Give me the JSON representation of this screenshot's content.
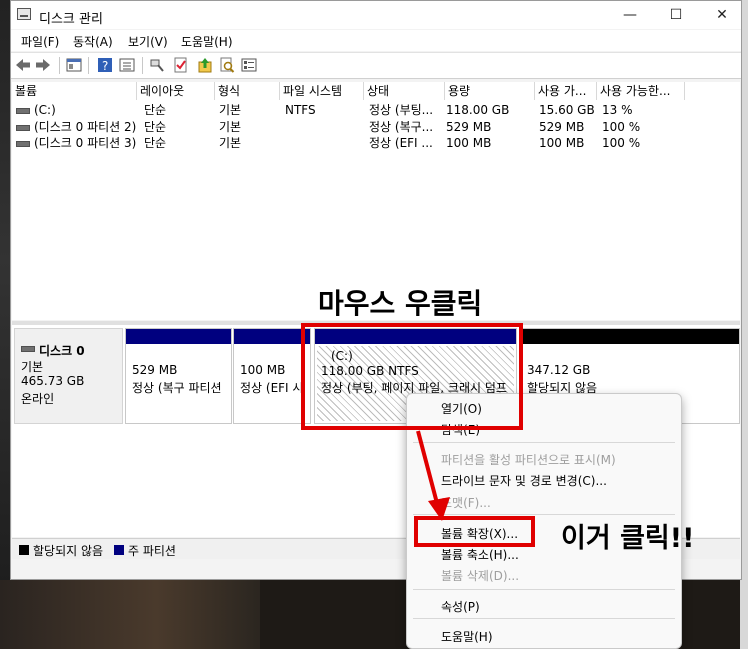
{
  "window": {
    "title": "디스크 관리",
    "minimize": "—",
    "maximize": "☐",
    "close": "✕"
  },
  "menu": [
    "파일(F)",
    "동작(A)",
    "보기(V)",
    "도움말(H)"
  ],
  "toolbar_icons": [
    "back-arrow-icon",
    "forward-arrow-icon",
    "console-icon",
    "help-icon",
    "properties-icon",
    "connect-icon",
    "check-icon",
    "upload-icon",
    "search-icon",
    "list-icon"
  ],
  "volume_table": {
    "headers": [
      "볼륨",
      "레이아웃",
      "형식",
      "파일 시스템",
      "상태",
      "용량",
      "사용 가...",
      "사용 가능한..."
    ],
    "rows": [
      [
        "(C:)",
        "단순",
        "기본",
        "NTFS",
        "정상 (부팅...",
        "118.00 GB",
        "15.60 GB",
        "13 %"
      ],
      [
        "(디스크 0 파티션 2)",
        "단순",
        "기본",
        "",
        "정상 (복구...",
        "529 MB",
        "529 MB",
        "100 %"
      ],
      [
        "(디스크 0 파티션 3)",
        "단순",
        "기본",
        "",
        "정상 (EFI ...",
        "100 MB",
        "100 MB",
        "100 %"
      ]
    ]
  },
  "disk": {
    "name": "디스크 0",
    "type": "기본",
    "size": "465.73 GB",
    "status": "온라인"
  },
  "partitions": [
    {
      "label": "",
      "size": "529 MB",
      "status": "정상 (복구 파티션"
    },
    {
      "label": "",
      "size": "100 MB",
      "status": "정상 (EFI 시"
    },
    {
      "label": "(C:)",
      "size": "118.00 GB NTFS",
      "status": "정상 (부팅, 페이지 파일, 크래시 덤프"
    },
    {
      "label": "",
      "size": "347.12 GB",
      "status": "할당되지 않음"
    }
  ],
  "legend": [
    {
      "label": "할당되지 않음",
      "color": "#000000"
    },
    {
      "label": "주 파티션",
      "color": "#00007f"
    }
  ],
  "context_menu": [
    {
      "label": "열기(O)",
      "enabled": true
    },
    {
      "label": "탐색(E)",
      "enabled": true
    },
    {
      "label": "파티션을 활성 파티션으로 표시(M)",
      "enabled": false
    },
    {
      "label": "드라이브 문자 및 경로 변경(C)...",
      "enabled": true
    },
    {
      "label": "포맷(F)...",
      "enabled": false
    },
    {
      "label": "볼륨 확장(X)...",
      "enabled": true
    },
    {
      "label": "볼륨 축소(H)...",
      "enabled": true
    },
    {
      "label": "볼륨 삭제(D)...",
      "enabled": false
    },
    {
      "label": "속성(P)",
      "enabled": true
    },
    {
      "label": "도움말(H)",
      "enabled": true
    }
  ],
  "annotations": {
    "right_click": "마우스 우클릭",
    "click_this": "이거 클릭!!"
  },
  "colors": {
    "primary_partition": "#00007f",
    "unallocated": "#000000",
    "highlight": "#e00000"
  }
}
